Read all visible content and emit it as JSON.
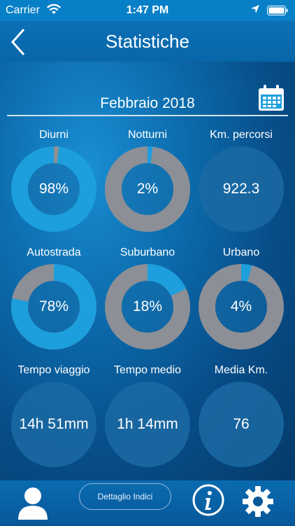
{
  "status": {
    "carrier": "Carrier",
    "time": "1:47 PM"
  },
  "nav": {
    "title": "Statistiche"
  },
  "period": {
    "month": "Febbraio 2018"
  },
  "colors": {
    "accent": "#1c9fdc",
    "track": "#8c8f96",
    "circle": "#1b6aa3"
  },
  "stats": [
    {
      "label": "Diurni",
      "value": "98%",
      "fraction": 0.98,
      "kind": "ring-accent-track"
    },
    {
      "label": "Notturni",
      "value": "2%",
      "fraction": 0.02,
      "kind": "ring"
    },
    {
      "label": "Km. percorsi",
      "value": "922.3",
      "kind": "plain"
    },
    {
      "label": "Autostrada",
      "value": "78%",
      "fraction": 0.78,
      "kind": "ring"
    },
    {
      "label": "Suburbano",
      "value": "18%",
      "fraction": 0.18,
      "kind": "ring"
    },
    {
      "label": "Urbano",
      "value": "4%",
      "fraction": 0.04,
      "kind": "ring"
    },
    {
      "label": "Tempo viaggio",
      "value": "14h 51mm",
      "kind": "plain"
    },
    {
      "label": "Tempo medio",
      "value": "1h 14mm",
      "kind": "plain"
    },
    {
      "label": "Media Km.",
      "value": "76",
      "kind": "plain"
    }
  ],
  "toolbar": {
    "detail_label": "Dettaglio Indici"
  }
}
